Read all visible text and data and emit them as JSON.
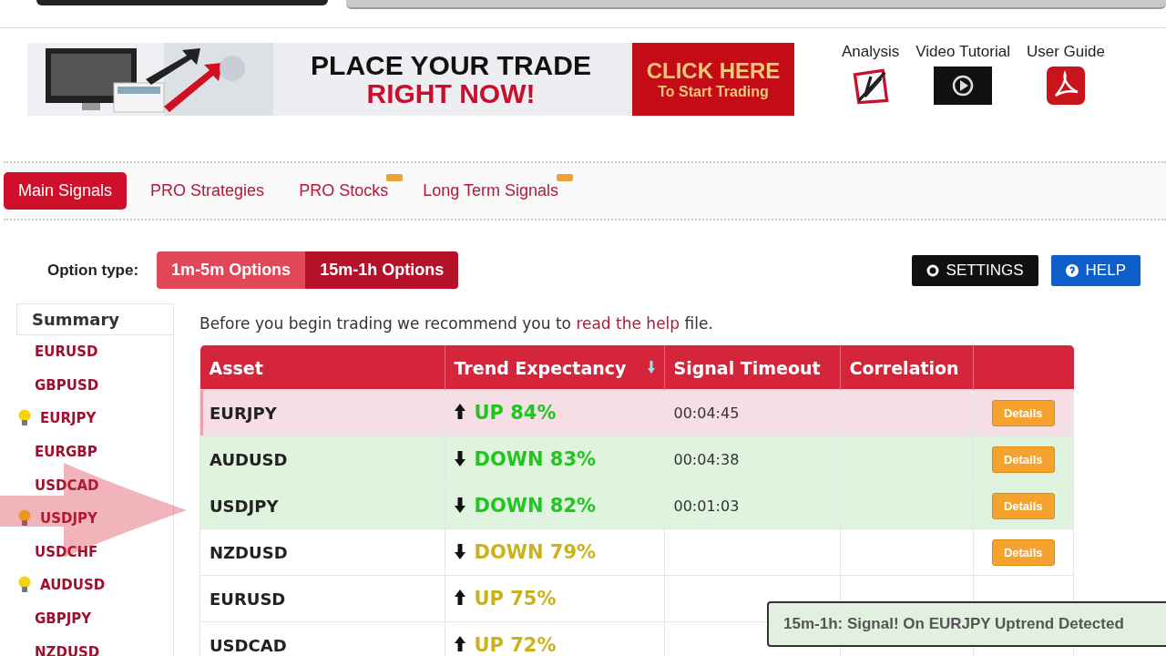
{
  "banner": {
    "headline": "PLACE YOUR TRADE",
    "subline": "RIGHT NOW!",
    "cta_title": "CLICK HERE",
    "cta_sub": "To Start Trading"
  },
  "resources": [
    {
      "label": "Analysis",
      "kind": "analysis"
    },
    {
      "label": "Video Tutorial",
      "kind": "video"
    },
    {
      "label": "User Guide",
      "kind": "pdf"
    }
  ],
  "tabs": [
    {
      "label": "Main Signals",
      "selected": true,
      "new": false
    },
    {
      "label": "PRO Strategies",
      "selected": false,
      "new": false
    },
    {
      "label": "PRO Stocks",
      "selected": false,
      "new": true
    },
    {
      "label": "Long Term Signals",
      "selected": false,
      "new": true
    }
  ],
  "option_type": {
    "label": "Option type:",
    "options": [
      {
        "label": "1m-5m Options",
        "selected": false
      },
      {
        "label": "15m-1h Options",
        "selected": true
      }
    ]
  },
  "buttons": [
    {
      "label": "SETTINGS",
      "kind": "settings"
    },
    {
      "label": "HELP",
      "kind": "help"
    }
  ],
  "sidebar": {
    "title": "Summary",
    "items": [
      {
        "label": "EURUSD",
        "signal": false
      },
      {
        "label": "GBPUSD",
        "signal": false
      },
      {
        "label": "EURJPY",
        "signal": true
      },
      {
        "label": "EURGBP",
        "signal": false
      },
      {
        "label": "USDCAD",
        "signal": false
      },
      {
        "label": "USDJPY",
        "signal": true
      },
      {
        "label": "USDCHF",
        "signal": false
      },
      {
        "label": "AUDUSD",
        "signal": true
      },
      {
        "label": "GBPJPY",
        "signal": false
      },
      {
        "label": "NZDUSD",
        "signal": false
      }
    ]
  },
  "intro": {
    "before": "Before you begin trading we recommend you to ",
    "link": "read the help",
    "after": " file."
  },
  "table": {
    "columns": [
      "Asset",
      "Trend Expectancy",
      "Signal Timeout",
      "Correlation"
    ],
    "rows": [
      {
        "asset": "EURJPY",
        "up": true,
        "trend": "UP 84%",
        "color": "#22c422",
        "timeout": "00:04:45",
        "latest": true,
        "active": false,
        "details": "Details"
      },
      {
        "asset": "AUDUSD",
        "up": false,
        "trend": "DOWN 83%",
        "color": "#22c422",
        "timeout": "00:04:38",
        "latest": false,
        "active": true,
        "details": "Details"
      },
      {
        "asset": "USDJPY",
        "up": false,
        "trend": "DOWN 82%",
        "color": "#22c422",
        "timeout": "00:01:03",
        "latest": false,
        "active": true,
        "details": "Details"
      },
      {
        "asset": "NZDUSD",
        "up": false,
        "trend": "DOWN 79%",
        "color": "#c9b21c",
        "latest": false,
        "active": false,
        "details": "Details"
      },
      {
        "asset": "EURUSD",
        "up": true,
        "trend": "UP 75%",
        "color": "#c9b21c",
        "latest": false,
        "active": false
      },
      {
        "asset": "USDCAD",
        "up": true,
        "trend": "UP 72%",
        "color": "#c9b21c",
        "latest": false,
        "active": false
      }
    ]
  },
  "toast": {
    "message": "15m-1h: Signal! On EURJPY Uptrend Detected"
  }
}
